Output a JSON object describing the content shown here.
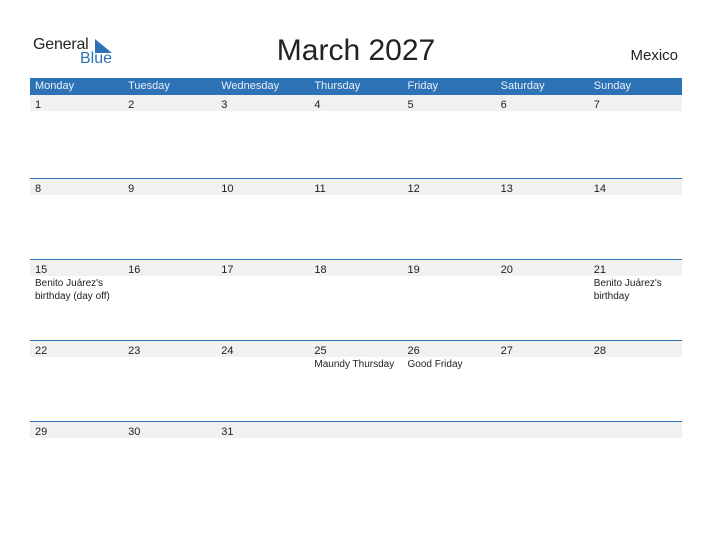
{
  "logo": {
    "general": "General",
    "blue": "Blue"
  },
  "title": "March 2027",
  "country": "Mexico",
  "weekdays": [
    "Monday",
    "Tuesday",
    "Wednesday",
    "Thursday",
    "Friday",
    "Saturday",
    "Sunday"
  ],
  "weeks": [
    [
      {
        "day": "1"
      },
      {
        "day": "2"
      },
      {
        "day": "3"
      },
      {
        "day": "4"
      },
      {
        "day": "5"
      },
      {
        "day": "6"
      },
      {
        "day": "7"
      }
    ],
    [
      {
        "day": "8"
      },
      {
        "day": "9"
      },
      {
        "day": "10"
      },
      {
        "day": "11"
      },
      {
        "day": "12"
      },
      {
        "day": "13"
      },
      {
        "day": "14"
      }
    ],
    [
      {
        "day": "15",
        "holiday": "Benito Juárez's birthday (day off)"
      },
      {
        "day": "16"
      },
      {
        "day": "17"
      },
      {
        "day": "18"
      },
      {
        "day": "19"
      },
      {
        "day": "20"
      },
      {
        "day": "21",
        "holiday": "Benito Juárez's birthday"
      }
    ],
    [
      {
        "day": "22"
      },
      {
        "day": "23"
      },
      {
        "day": "24"
      },
      {
        "day": "25",
        "holiday": "Maundy Thursday"
      },
      {
        "day": "26",
        "holiday": "Good Friday"
      },
      {
        "day": "27"
      },
      {
        "day": "28"
      }
    ],
    [
      {
        "day": "29"
      },
      {
        "day": "30"
      },
      {
        "day": "31"
      },
      {
        "day": ""
      },
      {
        "day": ""
      },
      {
        "day": ""
      },
      {
        "day": ""
      }
    ]
  ],
  "colors": {
    "accent": "#2e72b6",
    "strip": "#f1f1f1"
  }
}
